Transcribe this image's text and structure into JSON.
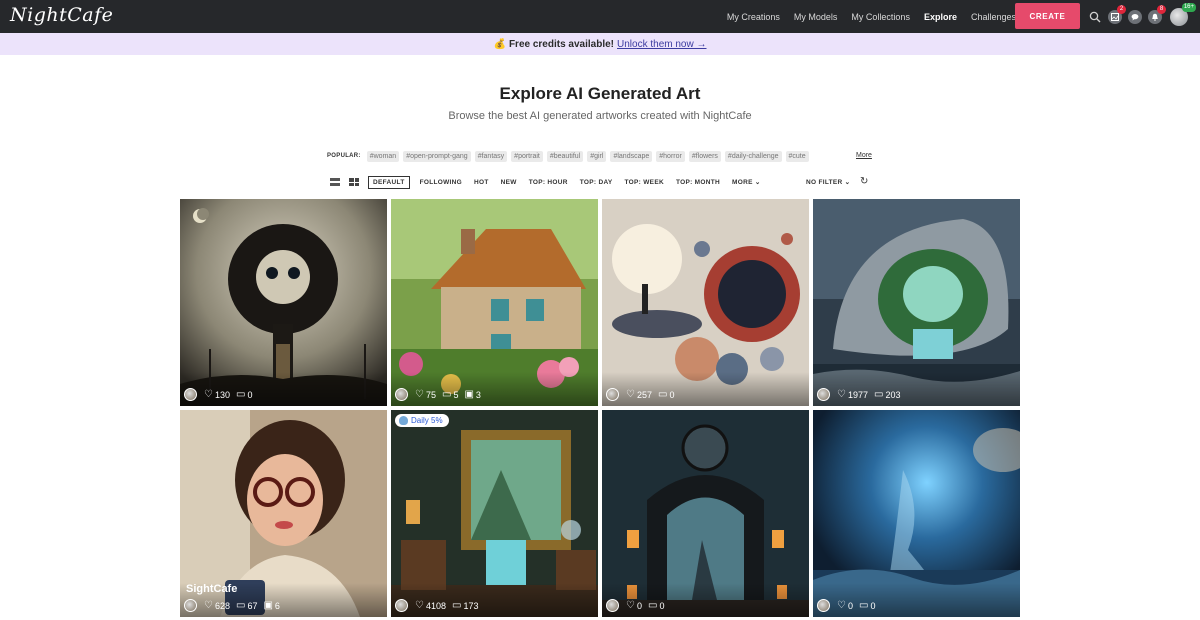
{
  "brand": {
    "logo_text": "NightCafe"
  },
  "nav": {
    "links": [
      "My Creations",
      "My Models",
      "My Collections",
      "Explore",
      "Challenges"
    ],
    "active": "Explore",
    "create_label": "CREATE",
    "badges": {
      "gallery": "2",
      "notifications": "8",
      "age": "16+"
    }
  },
  "promo": {
    "emoji": "💰",
    "bold": "Free credits available!",
    "link": "Unlock them now →"
  },
  "header": {
    "title": "Explore AI Generated Art",
    "subtitle": "Browse the best AI generated artworks created with NightCafe"
  },
  "popular": {
    "label": "POPULAR:",
    "tags": [
      "#woman",
      "#open-prompt-gang",
      "#fantasy",
      "#portrait",
      "#beautiful",
      "#girl",
      "#landscape",
      "#horror",
      "#flowers",
      "#daily-challenge",
      "#cute"
    ],
    "more": "More"
  },
  "sort": {
    "tabs": [
      "DEFAULT",
      "FOLLOWING",
      "HOT",
      "NEW",
      "TOP: HOUR",
      "TOP: DAY",
      "TOP: WEEK",
      "TOP: MONTH",
      "MORE"
    ],
    "active": "DEFAULT",
    "filter": "NO FILTER"
  },
  "cards": [
    {
      "likes": "130",
      "comments": "0",
      "images": null,
      "title": null,
      "badge": null
    },
    {
      "likes": "75",
      "comments": "5",
      "images": "3",
      "title": null,
      "badge": null
    },
    {
      "likes": "257",
      "comments": "0",
      "images": null,
      "title": null,
      "badge": null
    },
    {
      "likes": "1977",
      "comments": "203",
      "images": null,
      "title": null,
      "badge": null
    },
    {
      "likes": "628",
      "comments": "67",
      "images": "6",
      "title": "SightCafe",
      "badge": null
    },
    {
      "likes": "4108",
      "comments": "173",
      "images": null,
      "title": null,
      "badge": "Daily 5%"
    },
    {
      "likes": "0",
      "comments": "0",
      "images": null,
      "title": null,
      "badge": null
    },
    {
      "likes": "0",
      "comments": "0",
      "images": null,
      "title": null,
      "badge": null
    }
  ]
}
